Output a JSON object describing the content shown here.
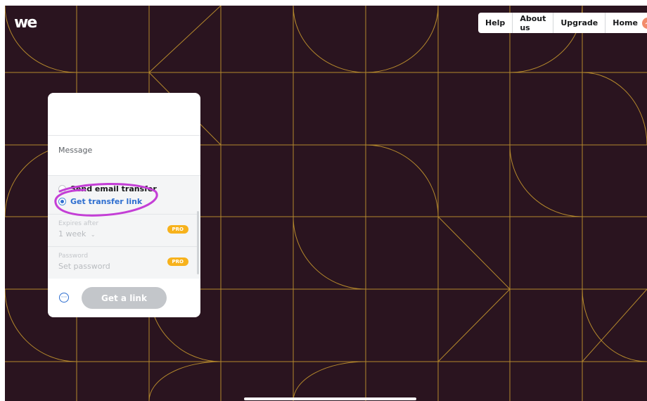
{
  "colors": {
    "background": "#2a141f",
    "pattern_line": "#b4882c",
    "accent_blue": "#2f6fd0",
    "pro_badge": "#f7b21c",
    "annotation": "#c43fd6"
  },
  "brand": {
    "logo_text": "we"
  },
  "nav": {
    "items": [
      {
        "label": "Help"
      },
      {
        "label": "About us"
      },
      {
        "label": "Upgrade"
      },
      {
        "label": "Home"
      }
    ],
    "avatar_icon": "user-avatar"
  },
  "panel": {
    "message_label": "Message",
    "transfer_options": [
      {
        "label": "Send email transfer",
        "selected": false
      },
      {
        "label": "Get transfer link",
        "selected": true
      }
    ],
    "expires": {
      "label": "Expires after",
      "value": "1 week",
      "badge": "PRO"
    },
    "password": {
      "label": "Password",
      "value": "Set password",
      "badge": "PRO"
    },
    "more_icon": "ellipsis-circle-icon",
    "get_link_label": "Get a link"
  }
}
